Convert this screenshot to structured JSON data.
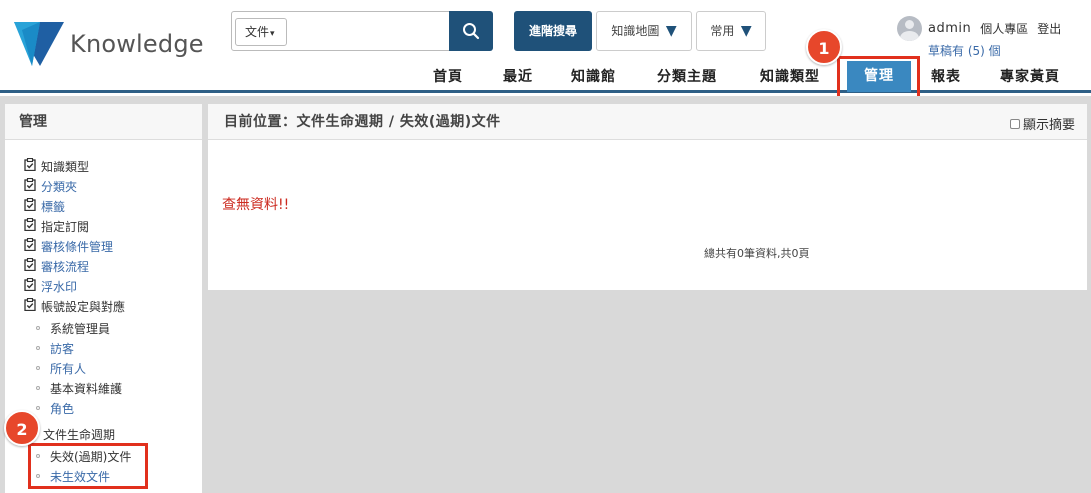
{
  "header": {
    "logo_text": "Knowledge",
    "search": {
      "type_label": "文件",
      "value": "",
      "placeholder": ""
    },
    "advanced_search": "進階搜尋",
    "knowledge_map": "知識地圖",
    "common": "常用",
    "user": {
      "name": "admin",
      "personal": "個人專區",
      "logout": "登出",
      "drafts": "草稿有 (5) 個"
    },
    "nav": [
      {
        "label": "首頁"
      },
      {
        "label": "最近"
      },
      {
        "label": "知識館"
      },
      {
        "label": "分類主題"
      },
      {
        "label": "知識類型"
      },
      {
        "label": "管理",
        "active": true
      },
      {
        "label": "報表"
      },
      {
        "label": "專家黃頁"
      }
    ]
  },
  "callouts": {
    "one": "1",
    "two": "2"
  },
  "sidebar": {
    "title": "管理",
    "items": [
      {
        "label": "知識類型",
        "link": false
      },
      {
        "label": "分類夾",
        "link": true
      },
      {
        "label": "標籤",
        "link": true
      },
      {
        "label": "指定訂閱",
        "link": false
      },
      {
        "label": "審核條件管理",
        "link": true
      },
      {
        "label": "審核流程",
        "link": true
      },
      {
        "label": "浮水印",
        "link": true
      },
      {
        "label": "帳號設定與對應",
        "link": false
      }
    ],
    "account_sub": [
      {
        "label": "系統管理員",
        "link": false
      },
      {
        "label": "訪客",
        "link": true
      },
      {
        "label": "所有人",
        "link": true
      },
      {
        "label": "基本資料維護",
        "link": false
      },
      {
        "label": "角色",
        "link": true
      }
    ],
    "lifecycle": {
      "label": "文件生命週期"
    },
    "lifecycle_sub": [
      {
        "label": "失效(過期)文件",
        "link": false
      },
      {
        "label": "未生效文件",
        "link": true
      }
    ]
  },
  "main": {
    "breadcrumb": "目前位置：文件生命週期 / 失效(過期)文件",
    "show_summary": "顯示摘要",
    "no_data": "查無資料!!",
    "total": "總共有0筆資料,共0頁"
  },
  "colors": {
    "primary": "#1f5179",
    "active_tab": "#3a88c0",
    "highlight": "#e1301d",
    "link": "#3a6aa8"
  }
}
